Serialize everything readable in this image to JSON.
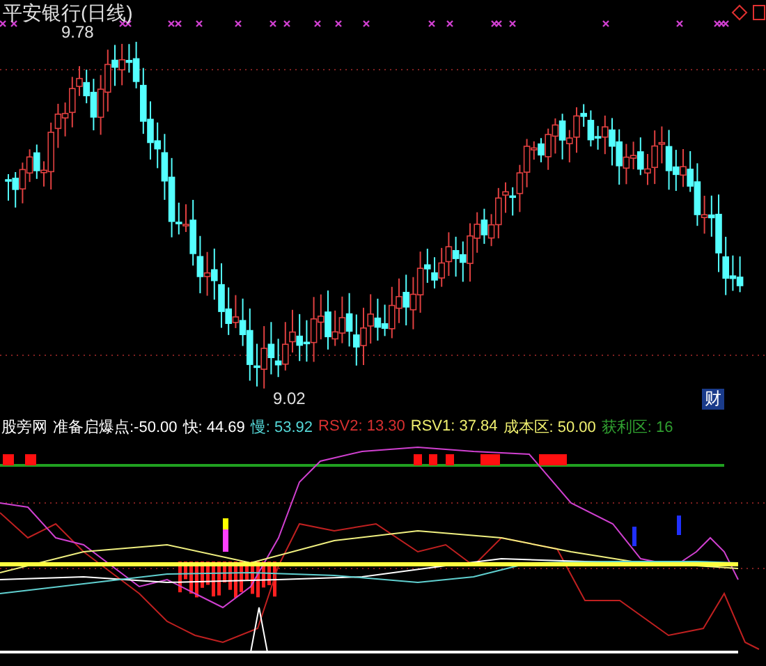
{
  "chart_title": "平安银行(日线)",
  "high_label": "9.78",
  "low_label": "9.02",
  "badge": "财",
  "legend": [
    {
      "text": "股旁网",
      "color": "#ffffff"
    },
    {
      "text": "准备启爆点:-50.00",
      "color": "#ffffff"
    },
    {
      "text": "快: 44.69",
      "color": "#ffffff"
    },
    {
      "text": "慢: 53.92",
      "color": "#55d8d8"
    },
    {
      "text": "RSV2: 13.30",
      "color": "#d83030"
    },
    {
      "text": "RSV1: 37.84",
      "color": "#f0f070"
    },
    {
      "text": "成本区: 50.00",
      "color": "#f0f070"
    },
    {
      "text": "获利区: 16",
      "color": "#30a030"
    }
  ]
}
